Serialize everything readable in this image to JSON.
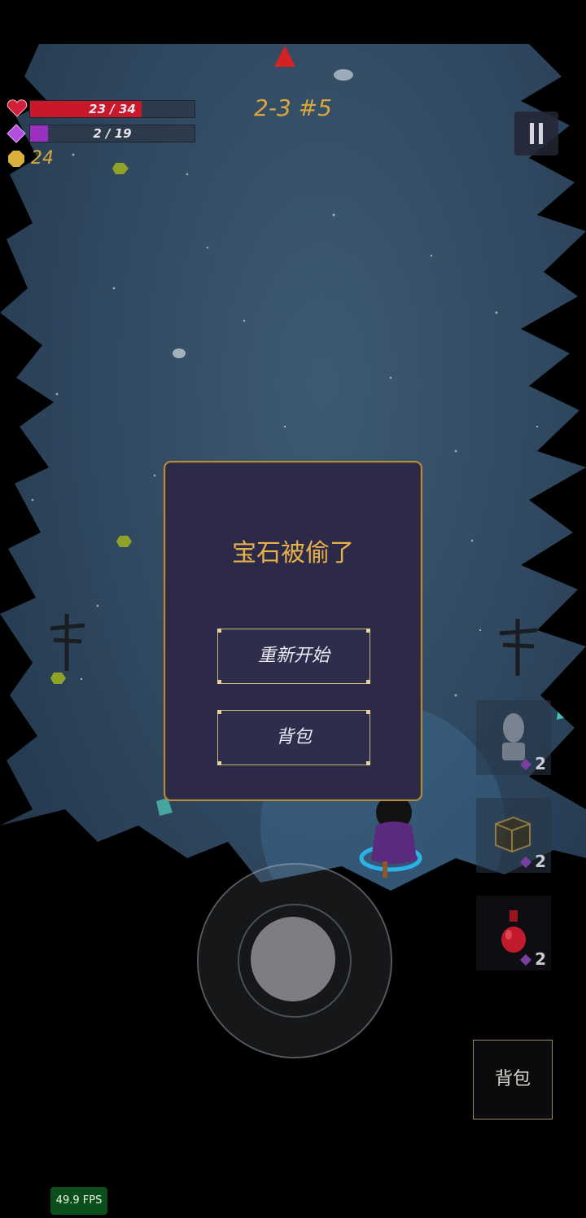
{
  "hud": {
    "hp_text": "23 / 34",
    "hp_fraction": 0.68,
    "mp_text": "2 / 19",
    "mp_fraction": 0.11,
    "gold": "24",
    "level": "2-3 #5",
    "icons": {
      "health": "heart-icon",
      "mana": "gem-icon",
      "gold": "coin-icon",
      "pause": "pause-icon",
      "direction": "arrow-up-icon"
    }
  },
  "dialog": {
    "title": "宝石被偷了",
    "restart_label": "重新开始",
    "bag_label": "背包"
  },
  "slots": [
    {
      "icon": "statue-icon",
      "count": "2"
    },
    {
      "icon": "crate-icon",
      "count": "2"
    },
    {
      "icon": "potion-icon",
      "count": "2"
    }
  ],
  "bag_button_label": "背包",
  "fps": "49.9 FPS",
  "colors": {
    "hp": "#c8182a",
    "mp": "#9a2fc0",
    "gold": "#d9a73d",
    "dialog_border": "#b08c48",
    "dialog_title": "#e8b04a"
  }
}
